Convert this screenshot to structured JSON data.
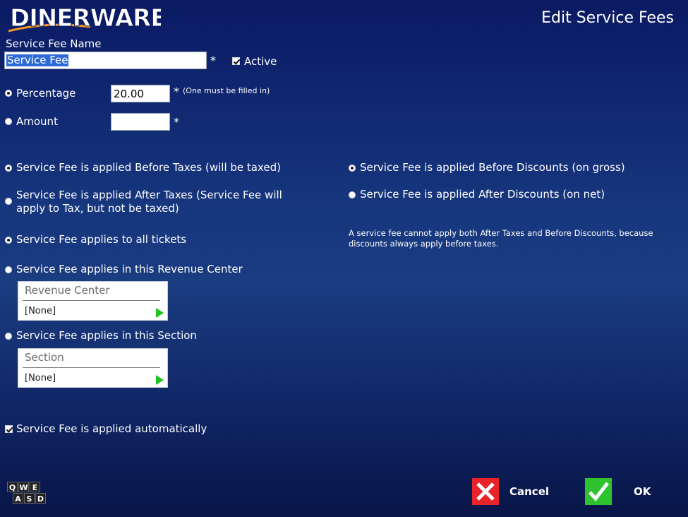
{
  "header": {
    "logo_text": "DINERWARE",
    "page_title": "Edit Service Fees"
  },
  "name": {
    "label": "Service Fee Name",
    "value": "Service Fee",
    "required_mark": "*",
    "active_label": "Active",
    "active_checked": true
  },
  "fee": {
    "percentage_label": "Percentage",
    "percentage_value": "20.00",
    "percentage_selected": true,
    "amount_label": "Amount",
    "amount_value": "",
    "amount_selected": false,
    "required_mark": "*",
    "hint": "(One must be filled in)"
  },
  "tax_options": {
    "before_taxes": "Service Fee is applied Before Taxes (will be taxed)",
    "after_taxes": "Service Fee is applied After Taxes (Service Fee will apply to Tax, but not be taxed)",
    "selected": "before_taxes"
  },
  "discount_options": {
    "before_discounts": "Service Fee is applied Before Discounts (on gross)",
    "after_discounts": "Service Fee is applied After Discounts (on net)",
    "selected": "before_discounts",
    "note": "A service fee cannot apply both After Taxes and Before Discounts, because discounts always apply before taxes."
  },
  "scope": {
    "all_tickets": "Service Fee applies to all tickets",
    "revenue_center": "Service Fee applies in this Revenue Center",
    "section": "Service Fee applies in this Section",
    "selected": "all_tickets",
    "revenue_center_dropdown": {
      "title": "Revenue Center",
      "value": "[None]"
    },
    "section_dropdown": {
      "title": "Section",
      "value": "[None]"
    }
  },
  "auto": {
    "label": "Service Fee is applied automatically",
    "checked": true
  },
  "keyboard": {
    "keys_row1": [
      "Q",
      "W",
      "E"
    ],
    "keys_row2": [
      "A",
      "S",
      "D"
    ]
  },
  "footer": {
    "cancel_label": "Cancel",
    "ok_label": "OK"
  },
  "colors": {
    "background_top": "#0a1a63",
    "background_mid": "#1a3c80",
    "cancel_red": "#e8232a",
    "ok_green": "#2ec32e",
    "dropdown_arrow": "#1fc21f",
    "logo_orange": "#f59a23"
  }
}
